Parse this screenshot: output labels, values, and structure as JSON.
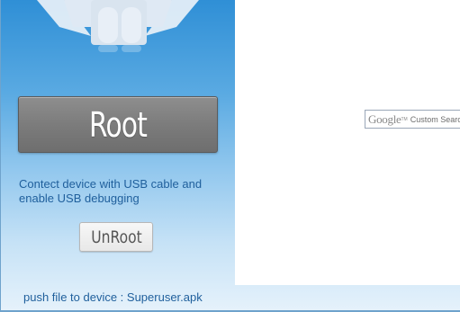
{
  "main": {
    "root_button_label": "Root",
    "instructions": "Contect device with USB cable and enable USB debugging",
    "unroot_button_label": "UnRoot"
  },
  "search": {
    "logo": "Google",
    "trademark": "TM",
    "placeholder": "Custom Search"
  },
  "status": {
    "text": "push file to device : Superuser.apk"
  },
  "icons": {
    "mascot": "android-robot-icon"
  }
}
